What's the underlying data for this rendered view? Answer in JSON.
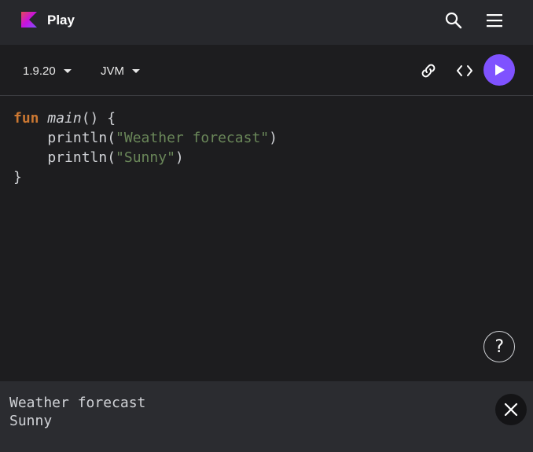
{
  "header": {
    "title": "Play",
    "logo_icon": "kotlin-logo-icon",
    "search_icon": "search-icon",
    "menu_icon": "hamburger-menu-icon"
  },
  "toolbar": {
    "version": "1.9.20",
    "platform": "JVM",
    "share_icon": "link-icon",
    "embed_icon": "code-brackets-icon",
    "run_icon": "play-icon"
  },
  "editor": {
    "lines": [
      [
        {
          "t": "kw",
          "v": "fun"
        },
        {
          "t": "plain",
          "v": " "
        },
        {
          "t": "fn-name",
          "v": "main"
        },
        {
          "t": "plain",
          "v": "() {"
        }
      ],
      [
        {
          "t": "plain",
          "v": "    println("
        },
        {
          "t": "str",
          "v": "\"Weather forecast\""
        },
        {
          "t": "plain",
          "v": ")"
        }
      ],
      [
        {
          "t": "plain",
          "v": "    println("
        },
        {
          "t": "str",
          "v": "\"Sunny\""
        },
        {
          "t": "plain",
          "v": ")"
        }
      ],
      [
        {
          "t": "plain",
          "v": "}"
        }
      ]
    ],
    "help_label": "?"
  },
  "console": {
    "output": [
      "Weather forecast",
      "Sunny"
    ],
    "close_icon": "close-icon"
  },
  "colors": {
    "accent": "#7f52ff",
    "keyword": "#cc7832",
    "string": "#6a8759",
    "header_bg": "#27282c",
    "editor_bg": "#1d1d1f",
    "console_bg": "#2b2c30"
  }
}
